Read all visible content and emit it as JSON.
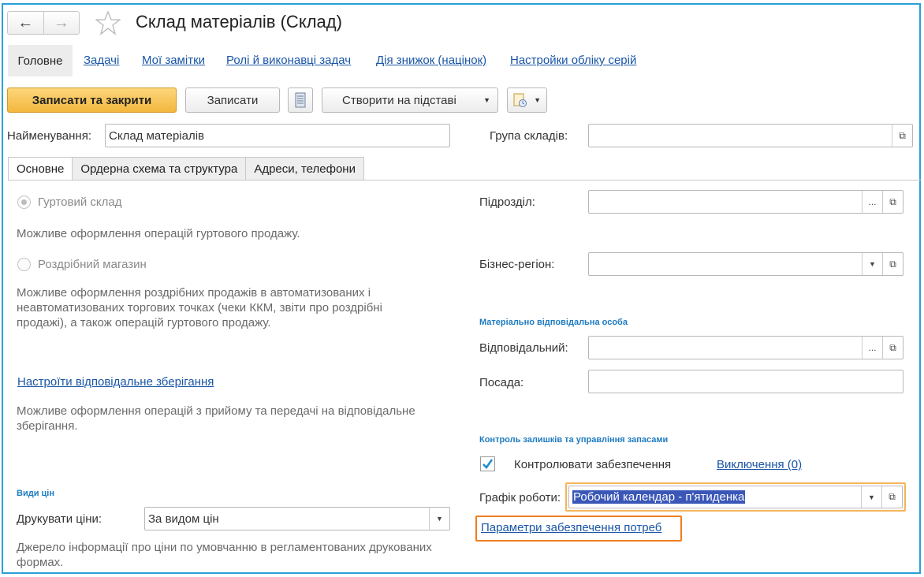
{
  "window": {
    "title": "Склад матеріалів (Склад)"
  },
  "nav": {
    "back_icon": "←",
    "forward_icon": "→"
  },
  "top_tabs": {
    "main": "Головне",
    "links": [
      "Задачі",
      "Мої замітки",
      "Ролі й виконавці задач",
      "Дія знижок (націнок)",
      "Настройки обліку серій"
    ]
  },
  "toolbar": {
    "save_close": "Записати та закрити",
    "save": "Записати",
    "create_based": "Створити на підставі"
  },
  "header_fields": {
    "name_label": "Найменування:",
    "name_value": "Склад матеріалів",
    "group_label": "Група складів:",
    "group_value": ""
  },
  "tabs": [
    "Основне",
    "Ордерна схема та структура",
    "Адреси, телефони"
  ],
  "left": {
    "radio_wholesale": "Гуртовий склад",
    "wholesale_desc": "Можливе оформлення операцій гуртового продажу.",
    "radio_retail": "Роздрібний магазин",
    "retail_desc": "Можливе оформлення роздрібних продажів в автоматизованих і неавтоматизованих торгових точках (чеки ККМ, звіти про роздрібні продажі), а також операцій гуртового продажу.",
    "custody_link": "Настроїти відповідальне зберігання",
    "custody_desc": "Можливе оформлення операцій з прийому та передачі на відповідальне зберігання.",
    "prices_section": "Види цін",
    "print_prices_label": "Друкувати ціни:",
    "print_prices_value": "За видом цін",
    "prices_desc": "Джерело інформації про ціни по умовчанню в регламентованих друкованих формах."
  },
  "right": {
    "division_label": "Підрозділ:",
    "division_value": "",
    "region_label": "Бізнес-регіон:",
    "region_value": "",
    "mol_section": "Матеріально відповідальна особа",
    "responsible_label": "Відповідальний:",
    "responsible_value": "",
    "position_label": "Посада:",
    "position_value": "",
    "stock_section": "Контроль залишків та управління запасами",
    "control_label": "Контролювати забезпечення",
    "control_checked": true,
    "exclusions_link": "Виключення (0)",
    "schedule_label": "Графік роботи:",
    "schedule_value": "Робочий календар - п'ятиденка",
    "params_link": "Параметри забезпечення потреб"
  },
  "colors": {
    "frame": "#2aa0d8",
    "primary_button": "#f3b63e",
    "link": "#1a56a6",
    "section": "#1e7bc0",
    "highlight_field": "#f6b45c",
    "highlight_link": "#f07d1e"
  }
}
